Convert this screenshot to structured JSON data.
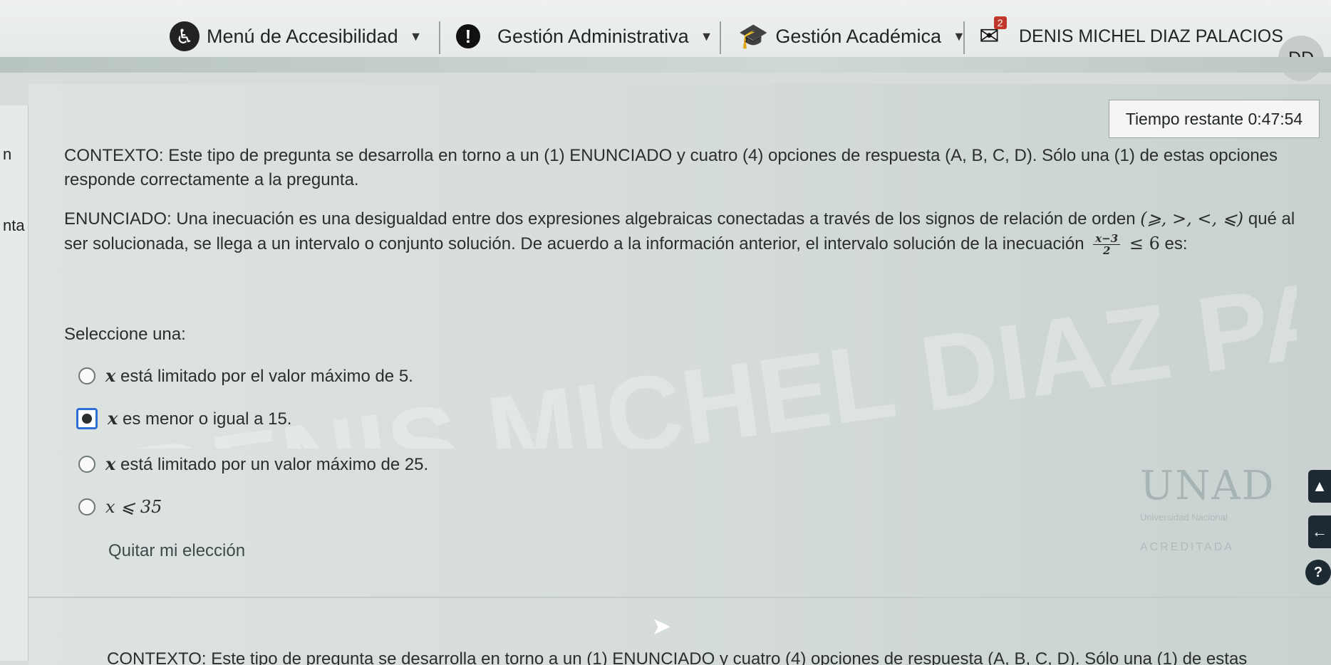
{
  "navbar": {
    "accessibility_menu": "Menú de Accesibilidad",
    "admin_menu": "Gestión Administrativa",
    "academic_menu": "Gestión Académica",
    "messages_badge": "2",
    "user_name": "DENIS MICHEL DIAZ PALACIOS",
    "avatar_initials": "DD"
  },
  "left_fragments": [
    "n",
    "nta"
  ],
  "timer": {
    "label": "Tiempo restante",
    "value": "0:47:54"
  },
  "question": {
    "context": "CONTEXTO: Este tipo de pregunta se desarrolla en torno a un (1) ENUNCIADO y cuatro (4) opciones de respuesta (A, B, C, D). Sólo una (1) de estas opciones responde correctamente a la pregunta.",
    "statement_part1": "ENUNCIADO: Una inecuación es una desigualdad entre dos expresiones algebraicas conectadas a través de los signos de relación de orden",
    "statement_symbols": "(⩾, >, <, ⩽)",
    "statement_part2": "qué al ser solucionada, se llega a un intervalo o conjunto solución. De acuerdo a la información anterior, el intervalo solución de",
    "statement_part3": "la inecuación",
    "fraction_numerator": "x−3",
    "fraction_denominator": "2",
    "inequality_rhs": "≤ 6",
    "statement_end": "es:"
  },
  "prompt": "Seleccione una:",
  "options": [
    {
      "var": "x",
      "text": "está limitado por el valor máximo de 5.",
      "selected": false
    },
    {
      "var": "x",
      "text": "es menor o igual a 15.",
      "selected": true
    },
    {
      "var": "x",
      "text": "está limitado por un valor máximo de 25.",
      "selected": false
    },
    {
      "var": "",
      "text": "x ⩽ 35",
      "selected": false
    }
  ],
  "clear_choice": "Quitar mi elección",
  "watermark_text": "DENIS MICHEL DIAZ PALACIOS",
  "logo": {
    "name": "UNAD",
    "subtitle": "Universidad Nacional",
    "accredited": "ACREDITADA"
  },
  "side_buttons": {
    "up_icon": "▲",
    "back_icon": "←",
    "help_icon": "?"
  },
  "next_question_context": "CONTEXTO: Este tipo de pregunta se desarrolla en torno a un (1) ENUNCIADO y cuatro (4) opciones de respuesta (A, B, C, D). Sólo una (1) de estas",
  "colors": {
    "selected_border": "#2e6fd6",
    "side_button_bg": "#1d2a33"
  }
}
